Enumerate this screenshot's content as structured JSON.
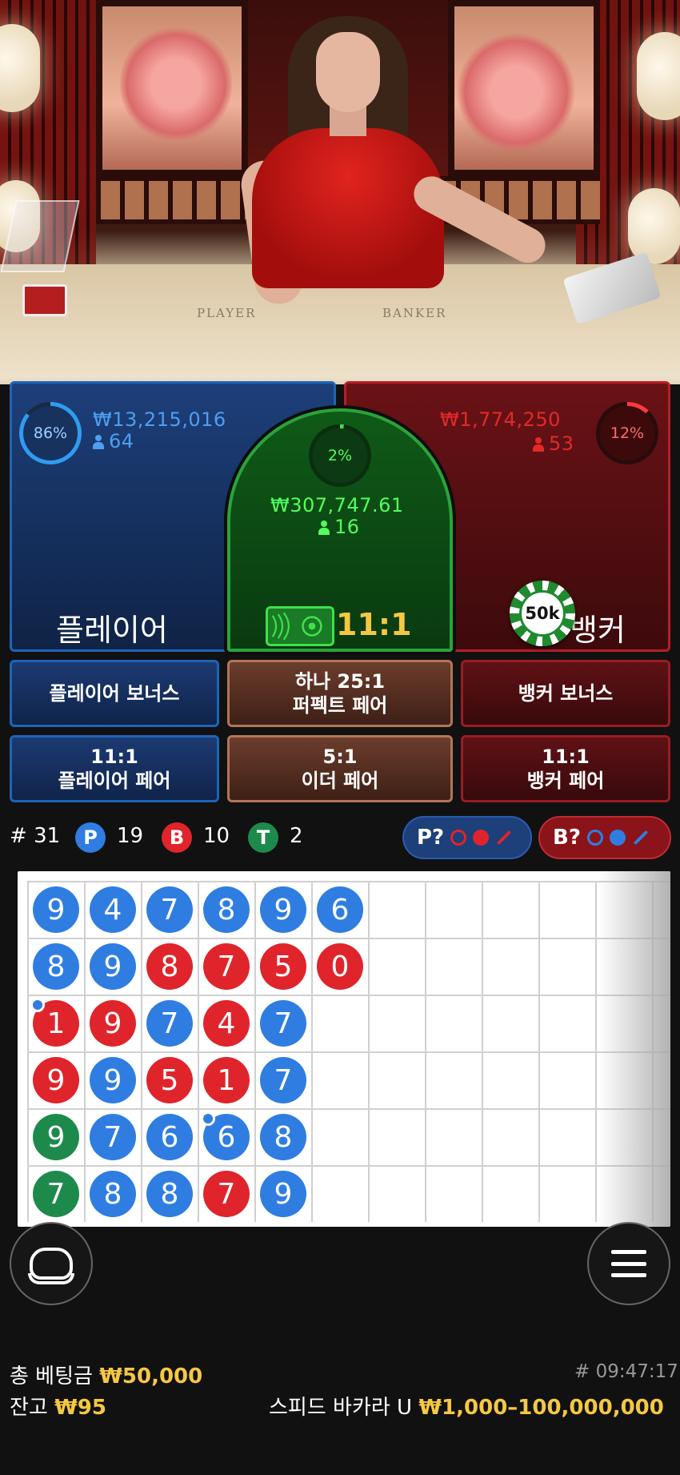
{
  "video": {
    "table_left_label": "PLAYER",
    "table_right_label": "BANKER"
  },
  "player": {
    "percent": "86%",
    "amount": "₩13,215,016",
    "players": "64",
    "title": "플레이어"
  },
  "banker": {
    "percent": "12%",
    "amount": "₩1,774,250",
    "players": "53",
    "title": "뱅커"
  },
  "tie": {
    "percent": "2%",
    "amount": "₩307,747.61",
    "players": "16",
    "payout": "11:1"
  },
  "chip": {
    "value": "50k"
  },
  "side_bets": {
    "player_bonus": "플레이어 보너스",
    "perfect_pair_line1": "하나 25:1",
    "perfect_pair_line2": "퍼펙트 페어",
    "banker_bonus": "뱅커 보너스",
    "player_pair_line1": "11:1",
    "player_pair_line2": "플레이어 페어",
    "either_pair_line1": "5:1",
    "either_pair_line2": "이더 페어",
    "banker_pair_line1": "11:1",
    "banker_pair_line2": "뱅커 페어"
  },
  "stats": {
    "round_prefix": "#",
    "round": "31",
    "p_label": "P",
    "p_count": "19",
    "b_label": "B",
    "b_count": "10",
    "t_label": "T",
    "t_count": "2",
    "p_predict": "P?",
    "b_predict": "B?"
  },
  "bead_road": [
    [
      {
        "v": "9",
        "c": "P"
      },
      {
        "v": "8",
        "c": "P"
      },
      {
        "v": "1",
        "c": "B",
        "pair": "P"
      },
      {
        "v": "9",
        "c": "B"
      },
      {
        "v": "9",
        "c": "T"
      },
      {
        "v": "7",
        "c": "T"
      }
    ],
    [
      {
        "v": "4",
        "c": "P"
      },
      {
        "v": "9",
        "c": "P"
      },
      {
        "v": "9",
        "c": "B"
      },
      {
        "v": "9",
        "c": "P"
      },
      {
        "v": "7",
        "c": "P"
      },
      {
        "v": "8",
        "c": "P"
      }
    ],
    [
      {
        "v": "7",
        "c": "P"
      },
      {
        "v": "8",
        "c": "B"
      },
      {
        "v": "7",
        "c": "P"
      },
      {
        "v": "5",
        "c": "B"
      },
      {
        "v": "6",
        "c": "P"
      },
      {
        "v": "8",
        "c": "P"
      }
    ],
    [
      {
        "v": "8",
        "c": "P"
      },
      {
        "v": "7",
        "c": "B"
      },
      {
        "v": "4",
        "c": "B"
      },
      {
        "v": "1",
        "c": "B"
      },
      {
        "v": "6",
        "c": "P",
        "pair": "P"
      },
      {
        "v": "7",
        "c": "B"
      }
    ],
    [
      {
        "v": "9",
        "c": "P"
      },
      {
        "v": "5",
        "c": "B"
      },
      {
        "v": "7",
        "c": "P"
      },
      {
        "v": "7",
        "c": "P"
      },
      {
        "v": "8",
        "c": "P"
      },
      {
        "v": "9",
        "c": "P"
      }
    ],
    [
      {
        "v": "6",
        "c": "P"
      },
      {
        "v": "0",
        "c": "B"
      }
    ]
  ],
  "colors": {
    "player": "#2f7de1",
    "banker": "#e0242b",
    "tie": "#1d8a4c",
    "gold": "#f5c842"
  },
  "icons": {
    "lobby": "lobby-icon",
    "menu": "menu-icon"
  },
  "footer": {
    "total_bet_label": "총 베팅금",
    "total_bet_value": "₩50,000",
    "time": "# 09:47:17",
    "balance_label": "잔고",
    "balance_value": "₩95",
    "game_name": "스피드 바카라 U",
    "limits": "₩1,000–100,000,000"
  }
}
